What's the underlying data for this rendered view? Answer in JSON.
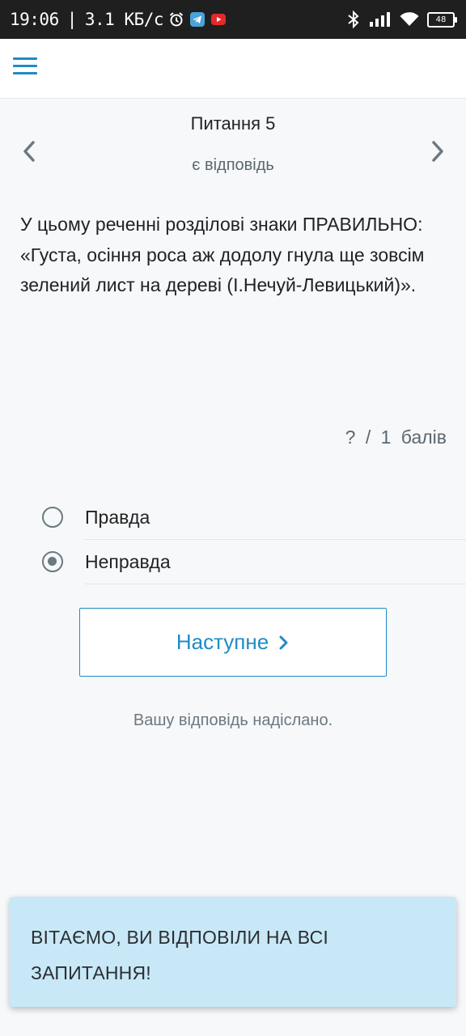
{
  "status_bar": {
    "time": "19:06",
    "network_speed": "3.1 КБ/с",
    "left_icons": [
      "alarm-icon",
      "telegram-icon",
      "youtube-icon"
    ],
    "right_icons": [
      "bluetooth-icon",
      "signal-icon",
      "wifi-icon",
      "battery-icon"
    ],
    "battery": "48"
  },
  "app_bar": {
    "menu_icon": "hamburger-menu-icon"
  },
  "question": {
    "title": "Питання 5",
    "status": "є відповідь",
    "text": "У цьому реченні розділові знаки ПРАВИЛЬНО: «Густа, осіння роса аж додолу гнула ще зовсім зелений лист на дереві (І.Нечуй-Левицький)».",
    "points": "? / 1 балів"
  },
  "options": [
    {
      "label": "Правда",
      "checked": false
    },
    {
      "label": "Неправда",
      "checked": true
    }
  ],
  "next_button": {
    "label": "Наступне"
  },
  "submitted_message": "Вашу відповідь надіслано.",
  "toast": {
    "text": "ВІТАЄМО, ВИ ВІДПОВІЛИ НА ВСІ ЗАПИТАННЯ!"
  },
  "colors": {
    "accent": "#1f8bc4",
    "toast_bg": "#c9e8f7",
    "background": "#f6f8fa"
  }
}
